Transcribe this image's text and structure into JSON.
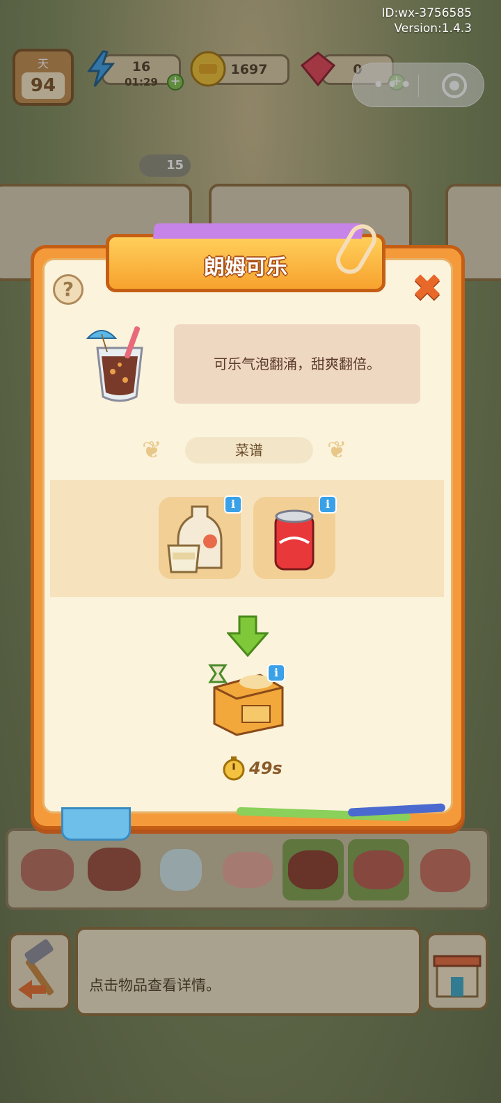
{
  "system": {
    "id_text": "ID:wx-3756585",
    "version_text": "Version:1.4.3"
  },
  "hud": {
    "day_label": "天",
    "day_value": "94",
    "energy_value": "16",
    "energy_timer": "01:29",
    "coins_value": "1697",
    "gems_value": "0",
    "tokens_value": "15"
  },
  "modal": {
    "title": "朗姆可乐",
    "help_symbol": "?",
    "close_symbol": "✖",
    "description": "可乐气泡翻涌，甜爽翻倍。",
    "recipe_label": "菜谱",
    "ingredients": [
      {
        "icon": "rum-bottle-icon",
        "info": "i"
      },
      {
        "icon": "cola-can-icon",
        "info": "i"
      }
    ],
    "station": {
      "icon": "kitchen-counter-icon",
      "info": "i"
    },
    "cook_time": "49s"
  },
  "bottom": {
    "message": "点击物品查看详情。"
  },
  "colors": {
    "modal_orange": "#f59a3a",
    "modal_cream": "#fbf3dc",
    "info_blue": "#3aa0e8",
    "arrow_green": "#7ec83a"
  }
}
